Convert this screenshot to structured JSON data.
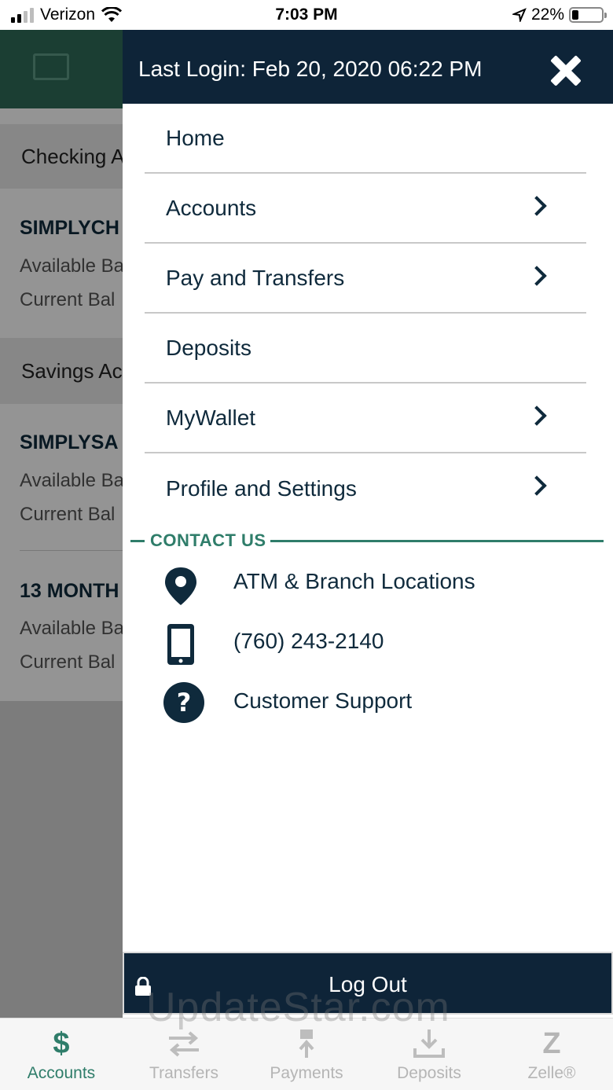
{
  "status_bar": {
    "carrier": "Verizon",
    "time": "7:03 PM",
    "battery": "22%",
    "battery_level": 0.22
  },
  "background": {
    "sections": [
      {
        "title": "Checking A",
        "accounts": [
          {
            "name": "SIMPLYCH",
            "available": "Available Ba",
            "current": "Current Bal"
          }
        ]
      },
      {
        "title": "Savings Ac",
        "accounts": [
          {
            "name": "SIMPLYSA",
            "available": "Available Ba",
            "current": "Current Bal"
          },
          {
            "name": "13 MONTH",
            "available": "Available Ba",
            "current": "Current Bal"
          }
        ]
      }
    ]
  },
  "drawer": {
    "last_login": "Last Login: Feb 20, 2020 06:22 PM",
    "menu": [
      {
        "label": "Home",
        "has_chevron": false
      },
      {
        "label": "Accounts",
        "has_chevron": true
      },
      {
        "label": "Pay and Transfers",
        "has_chevron": true
      },
      {
        "label": "Deposits",
        "has_chevron": false
      },
      {
        "label": "MyWallet",
        "has_chevron": true
      },
      {
        "label": "Profile and Settings",
        "has_chevron": true
      }
    ],
    "contact_heading": "CONTACT US",
    "contact": [
      {
        "icon": "map-pin-icon",
        "label": "ATM & Branch Locations"
      },
      {
        "icon": "phone-icon",
        "label": "(760) 243-2140"
      },
      {
        "icon": "question-icon",
        "label": "Customer Support"
      }
    ],
    "logout_label": "Log Out"
  },
  "tabs": [
    {
      "label": "Accounts",
      "icon": "dollar-icon",
      "active": true
    },
    {
      "label": "Transfers",
      "icon": "transfer-icon",
      "active": false
    },
    {
      "label": "Payments",
      "icon": "payment-icon",
      "active": false
    },
    {
      "label": "Deposits",
      "icon": "deposit-icon",
      "active": false
    },
    {
      "label": "Zelle®",
      "icon": "zelle-icon",
      "active": false
    }
  ],
  "watermark": "UpdateStar.com",
  "colors": {
    "navy": "#0e2438",
    "green": "#2f7d6a",
    "header_green": "#2f6b58"
  }
}
